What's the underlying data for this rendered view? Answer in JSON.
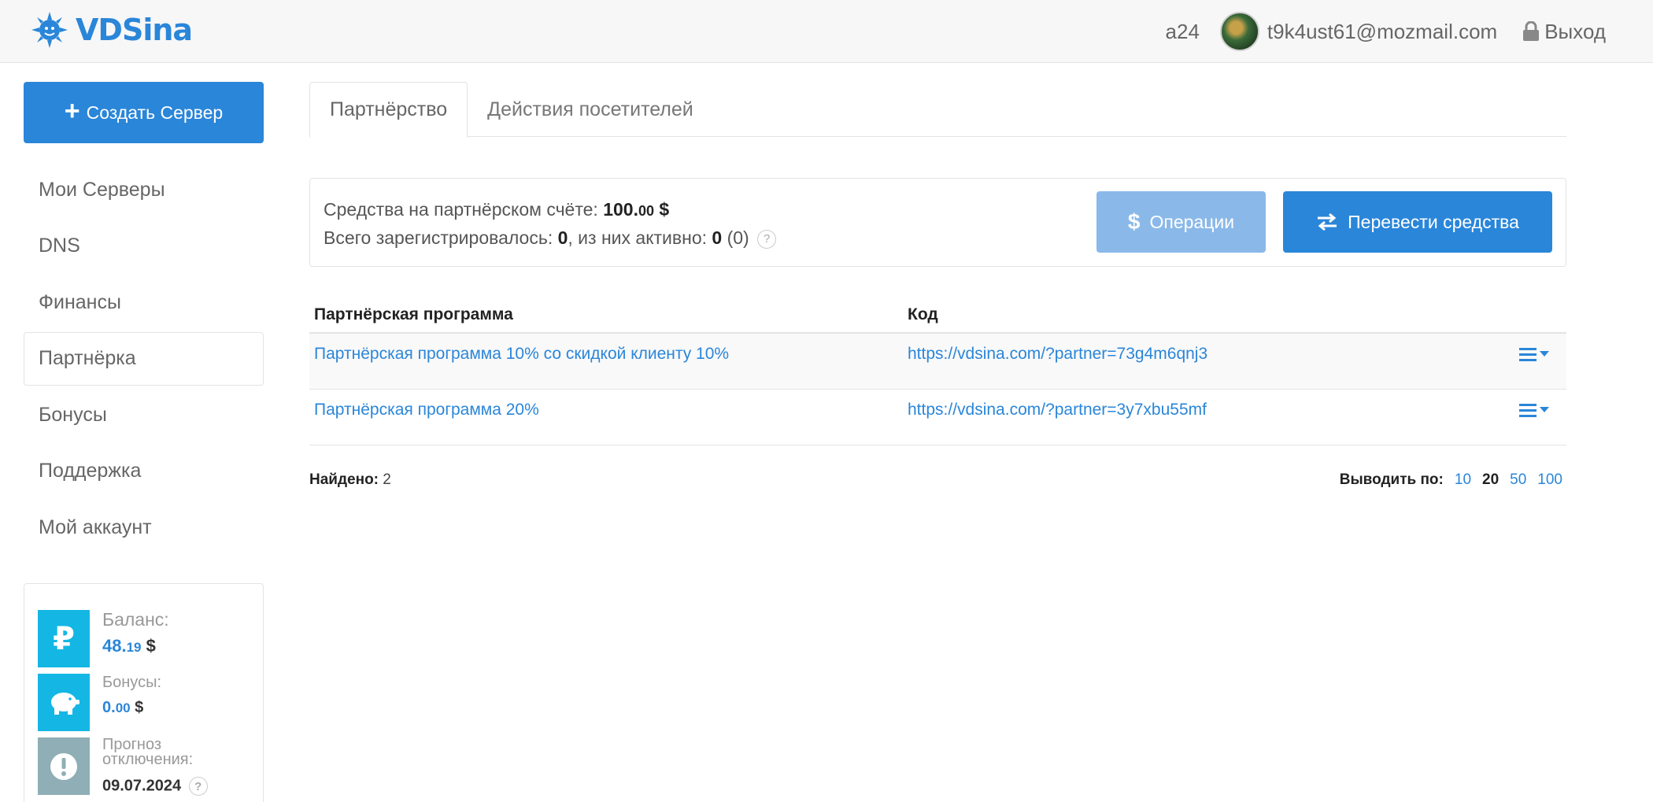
{
  "header": {
    "logo_text": "VDSina",
    "user_id": "a24",
    "email": "t9k4ust61@mozmail.com",
    "logout_label": "Выход"
  },
  "sidebar": {
    "create_button_label": "Создать Сервер",
    "items": [
      {
        "label": "Мои Серверы",
        "active": false
      },
      {
        "label": "DNS",
        "active": false
      },
      {
        "label": "Финансы",
        "active": false
      },
      {
        "label": "Партнёрка",
        "active": true
      },
      {
        "label": "Бонусы",
        "active": false
      },
      {
        "label": "Поддержка",
        "active": false
      },
      {
        "label": "Мой аккаунт",
        "active": false
      }
    ],
    "balance": {
      "balance_label": "Баланс:",
      "balance_int": "48.",
      "balance_cents": "19",
      "currency": "$",
      "bonus_label": "Бонусы:",
      "bonus_int": "0.",
      "bonus_cents": "00",
      "forecast_label": "Прогноз отключения:",
      "forecast_date": "09.07.2024"
    }
  },
  "tabs": [
    {
      "label": "Партнёрство",
      "active": true
    },
    {
      "label": "Действия посетителей",
      "active": false
    }
  ],
  "summary": {
    "funds_label": "Средства на партнёрском счёте:",
    "funds_int": "100.",
    "funds_cents": "00",
    "funds_currency": "$",
    "registered_label": "Всего зарегистрировалось:",
    "registered_count": "0",
    "active_label": ", из них активно:",
    "active_count": "0",
    "active_paren": "(0)",
    "help_glyph": "?",
    "operations_label": "Операции",
    "transfer_label": "Перевести средства"
  },
  "table": {
    "columns": [
      "Партнёрская программа",
      "Код"
    ],
    "rows": [
      {
        "program": "Партнёрская программа 10% со скидкой клиенту 10%",
        "code": "https://vdsina.com/?partner=73g4m6qnj3"
      },
      {
        "program": "Партнёрская программа 20%",
        "code": "https://vdsina.com/?partner=3y7xbu55mf"
      }
    ]
  },
  "footer": {
    "found_label": "Найдено:",
    "found_count": "2",
    "per_page_label": "Выводить по:",
    "per_page_options": [
      "10",
      "20",
      "50",
      "100"
    ],
    "per_page_selected": "20"
  },
  "colors": {
    "accent": "#2a86d9",
    "accent_light": "#8ab9e9",
    "balance_icon": "#14b7e4",
    "forecast_icon": "#8faeb6"
  }
}
